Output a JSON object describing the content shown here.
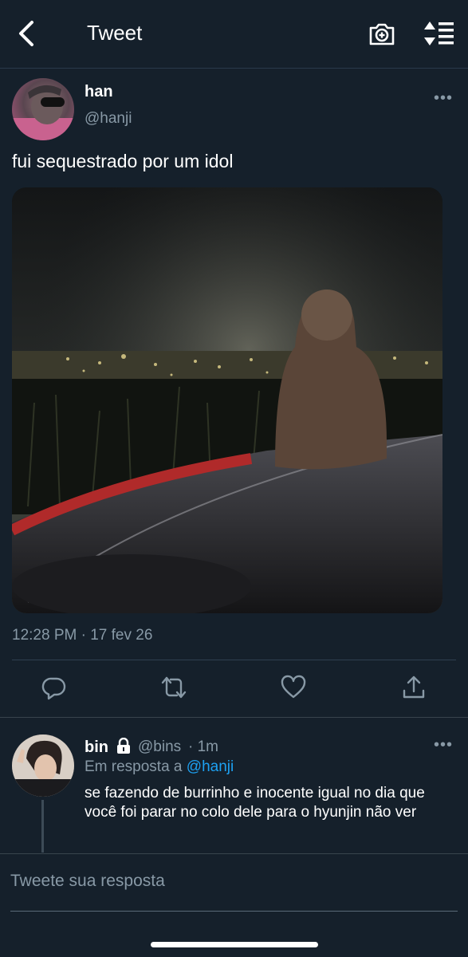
{
  "header": {
    "title": "Tweet",
    "back_icon": "chevron-left-icon",
    "camera_icon": "camera-plus-icon",
    "sort_icon": "sort-arrows-icon"
  },
  "tweet": {
    "author_name": "han",
    "author_handle": "@hanji",
    "more": "•••",
    "text": "fui sequestrado por um idol",
    "timestamp": "12:28 PM · 17 fev 26",
    "actions": [
      "reply-icon",
      "retweet-icon",
      "like-icon",
      "share-icon"
    ]
  },
  "reply": {
    "author_name": "bin",
    "author_handle": "@bins",
    "time": "· 1m",
    "more": "•••",
    "in_reply_prefix": "Em resposta a",
    "in_reply_handle": "@hanji",
    "text": "se fazendo de burrinho e inocente igual no dia que você foi parar no colo dele para o hyunjin não ver"
  },
  "composer": {
    "placeholder": "Tweete sua resposta"
  },
  "colors": {
    "background": "#15202b",
    "secondary_text": "#8899a6",
    "link": "#1da1f2",
    "divider": "#38444d"
  }
}
